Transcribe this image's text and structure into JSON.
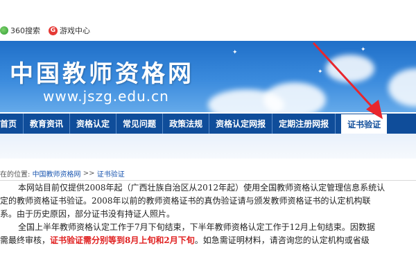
{
  "bookmarks": [
    {
      "label": "360搜索",
      "icon": "360-search-icon"
    },
    {
      "label": "游戏中心",
      "icon": "game-center-icon",
      "glyph": "G"
    }
  ],
  "banner": {
    "title": "中国教师资格网",
    "url": "www.jszg.edu.cn"
  },
  "nav": {
    "items": [
      "首页",
      "教育资讯",
      "资格认定",
      "常见问题",
      "政策法规",
      "资格认定网报",
      "定期注册网报"
    ],
    "active": "证书验证"
  },
  "breadcrumb": {
    "prefix": "在的位置:",
    "home": "中国教师资格网",
    "separator": ">>",
    "current": "证书验证"
  },
  "article": {
    "p1_l1": "本网站目前仅提供2008年起（广西壮族自治区从2012年起）使用全国教师资格认定管理信息系统认",
    "p1_l2": "定的教师资格证书验证。2008年以前的教师资格证书的真伪验证请与颁发教师资格证书的认定机构联",
    "p1_l3": "系。由于历史原因，部分证书没有持证人照片。",
    "p2_l1": "全国上半年教师资格认定工作于7月下旬结束，下半年教师资格认定工作于12月上旬结束。因数据",
    "p2_l2_a": "需最终审核，",
    "p2_l2_red": "证书验证需分别等到8月上旬和2月下旬",
    "p2_l2_b": "。如急需证明材料，请咨询您的认定机构或省级"
  },
  "colors": {
    "nav_bg": "#0f4d9a",
    "highlight_red": "#e02020",
    "arrow_red": "#e8262d"
  }
}
